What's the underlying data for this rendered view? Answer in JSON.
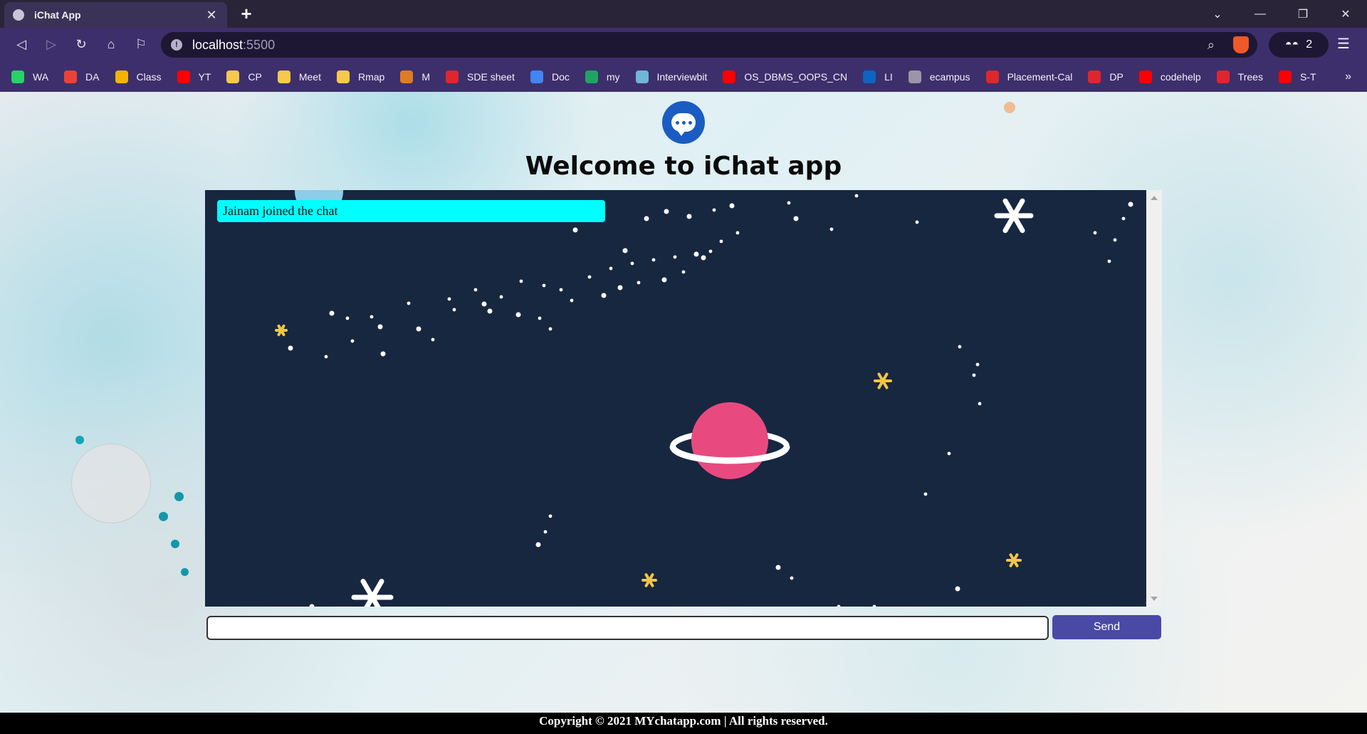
{
  "browser": {
    "tab_title": "iChat App",
    "tab_close": "✕",
    "new_tab": "+",
    "url_host": "localhost",
    "url_port": ":5500",
    "wallet_count": "2",
    "window_controls": [
      "⌄",
      "—",
      "❐",
      "✕"
    ],
    "bookmarks": [
      {
        "label": "WA",
        "icon": "whatsapp-icon",
        "color": "#25d366"
      },
      {
        "label": "DA",
        "icon": "gmail-icon",
        "color": "#ea4335"
      },
      {
        "label": "Class",
        "icon": "classroom-icon",
        "color": "#f4b400"
      },
      {
        "label": "YT",
        "icon": "youtube-icon",
        "color": "#ff0000"
      },
      {
        "label": "CP",
        "icon": "folder-icon",
        "color": "#f6c94c"
      },
      {
        "label": "Meet",
        "icon": "folder-icon",
        "color": "#f6c94c"
      },
      {
        "label": "Rmap",
        "icon": "folder-icon",
        "color": "#f6c94c"
      },
      {
        "label": "M",
        "icon": "m-icon",
        "color": "#e07b22"
      },
      {
        "label": "SDE sheet",
        "icon": "tuf-icon",
        "color": "#e0262d"
      },
      {
        "label": "Doc",
        "icon": "docs-icon",
        "color": "#4285f4"
      },
      {
        "label": "my",
        "icon": "drive-icon",
        "color": "#1fa463"
      },
      {
        "label": "Interviewbit",
        "icon": "interviewbit-icon",
        "color": "#6fb7d6"
      },
      {
        "label": "OS_DBMS_OOPS_CN",
        "icon": "youtube-icon",
        "color": "#ff0000"
      },
      {
        "label": "LI",
        "icon": "linkedin-icon",
        "color": "#0a66c2"
      },
      {
        "label": "ecampus",
        "icon": "globe-icon",
        "color": "#9a96a8"
      },
      {
        "label": "Placement-Cal",
        "icon": "tuf-icon",
        "color": "#e0262d"
      },
      {
        "label": "DP",
        "icon": "tuf-icon",
        "color": "#e0262d"
      },
      {
        "label": "codehelp",
        "icon": "youtube-icon",
        "color": "#ff0000"
      },
      {
        "label": "Trees",
        "icon": "tuf-icon",
        "color": "#e0262d"
      },
      {
        "label": "S-T",
        "icon": "youtube-icon",
        "color": "#ff0000"
      }
    ],
    "more_bookmarks": "»"
  },
  "app": {
    "heading": "Welcome to iChat app",
    "messages": [
      {
        "text": "Jainam joined the chat",
        "type": "info",
        "color": "#00ffff"
      }
    ],
    "input_value": "",
    "send_label": "Send",
    "footer": "Copyright © 2021 MYchatapp.com | All rights reserved."
  },
  "colors": {
    "chat_bg": "#172740",
    "planet": "#e84a7f",
    "star_yellow": "#f4c542",
    "send_button": "#4a49a6",
    "logo_blue": "#1a5cc2"
  }
}
